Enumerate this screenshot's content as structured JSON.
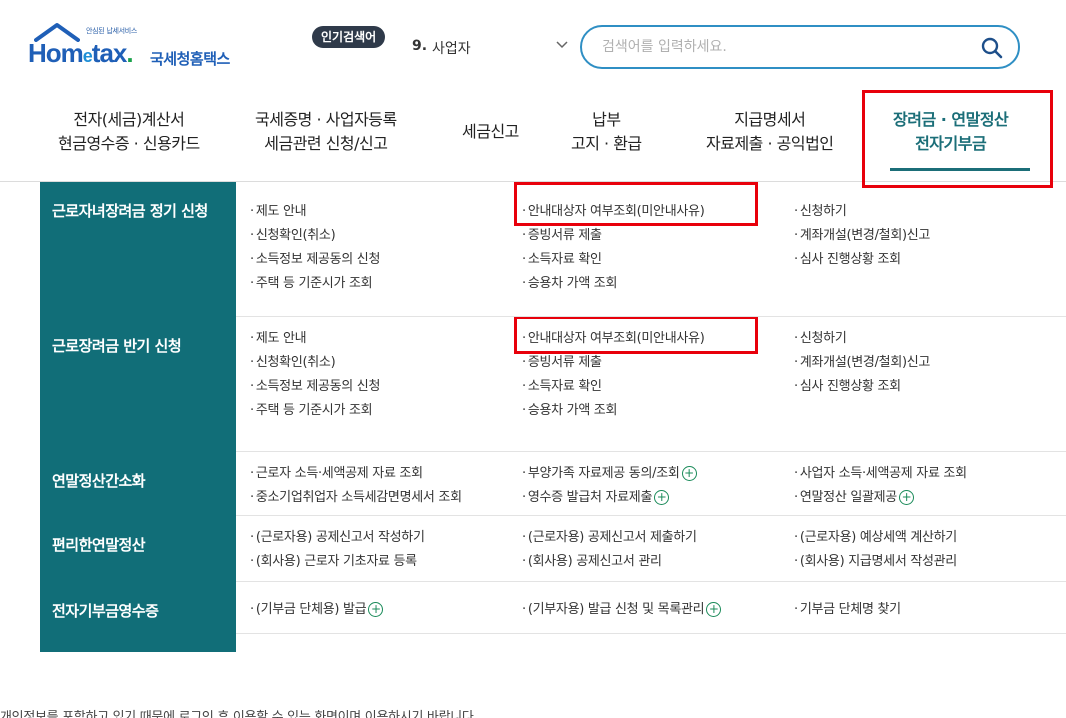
{
  "header": {
    "logo_small_text": "안심된 납세서비스",
    "logo_word": "Hometax",
    "logo_kr": "국세청홈택스",
    "popular_label": "인기검색어",
    "popular_rank": "9.",
    "popular_term": "사업자",
    "search_placeholder": "검색어를 입력하세요."
  },
  "nav": [
    {
      "line1": "전자(세금)계산서",
      "line2": "현금영수증 · 신용카드"
    },
    {
      "line1": "국세증명 · 사업자등록",
      "line2": "세금관련 신청/신고"
    },
    {
      "line1": "세금신고",
      "line2": ""
    },
    {
      "line1": "납부",
      "line2": "고지 · 환급"
    },
    {
      "line1": "지급명세서",
      "line2": "자료제출 · 공익법인"
    },
    {
      "line1": "장려금 · 연말정산",
      "line2": "전자기부금"
    }
  ],
  "sections": [
    {
      "title": "근로자녀장려금 정기 신청",
      "col1": [
        "제도 안내",
        "신청확인(취소)",
        "소득정보 제공동의 신청",
        "주택 등 기준시가 조회"
      ],
      "col2": [
        "안내대상자 여부조회(미안내사유)",
        "증빙서류 제출",
        "소득자료 확인",
        "승용차 가액 조회"
      ],
      "col3": [
        "신청하기",
        "계좌개설(변경/철회)신고",
        "심사 진행상황 조회"
      ]
    },
    {
      "title": "근로장려금 반기 신청",
      "col1": [
        "제도 안내",
        "신청확인(취소)",
        "소득정보 제공동의 신청",
        "주택 등 기준시가 조회"
      ],
      "col2": [
        "안내대상자 여부조회(미안내사유)",
        "증빙서류 제출",
        "소득자료 확인",
        "승용차 가액 조회"
      ],
      "col3": [
        "신청하기",
        "계좌개설(변경/철회)신고",
        "심사 진행상황 조회"
      ]
    },
    {
      "title": "연말정산간소화",
      "col1": [
        "근로자 소득·세액공제 자료 조회",
        "중소기업취업자 소득세감면명세서 조회"
      ],
      "col2": [
        "부양가족 자료제공 동의/조회",
        "영수증 발급처 자료제출"
      ],
      "col3": [
        "사업자 소득·세액공제 자료 조회",
        "연말정산 일괄제공"
      ]
    },
    {
      "title": "편리한연말정산",
      "col1": [
        "(근로자용) 공제신고서 작성하기",
        "(회사용) 근로자 기초자료 등록"
      ],
      "col2": [
        "(근로자용) 공제신고서 제출하기",
        "(회사용) 공제신고서 관리"
      ],
      "col3": [
        "(근로자용) 예상세액 계산하기",
        "(회사용) 지급명세서 작성관리"
      ]
    },
    {
      "title": "전자기부금영수증",
      "col1": [
        "(기부금 단체용) 발급"
      ],
      "col2": [
        "(기부자용) 발급 신청 및 목록관리"
      ],
      "col3": [
        "기부금 단체명 찾기"
      ]
    }
  ],
  "footer_note": "개인정보를 포함하고 있기 때문에 로그인 후 이용할 수 있는 화면이며 이용하시기 바랍니다.",
  "colors": {
    "accent": "#116e78",
    "highlight": "#e8000b",
    "search_border": "#2f8fc4"
  },
  "icons": [
    "house-roof-icon",
    "chevron-down-icon",
    "search-icon",
    "plus-circle-icon"
  ]
}
